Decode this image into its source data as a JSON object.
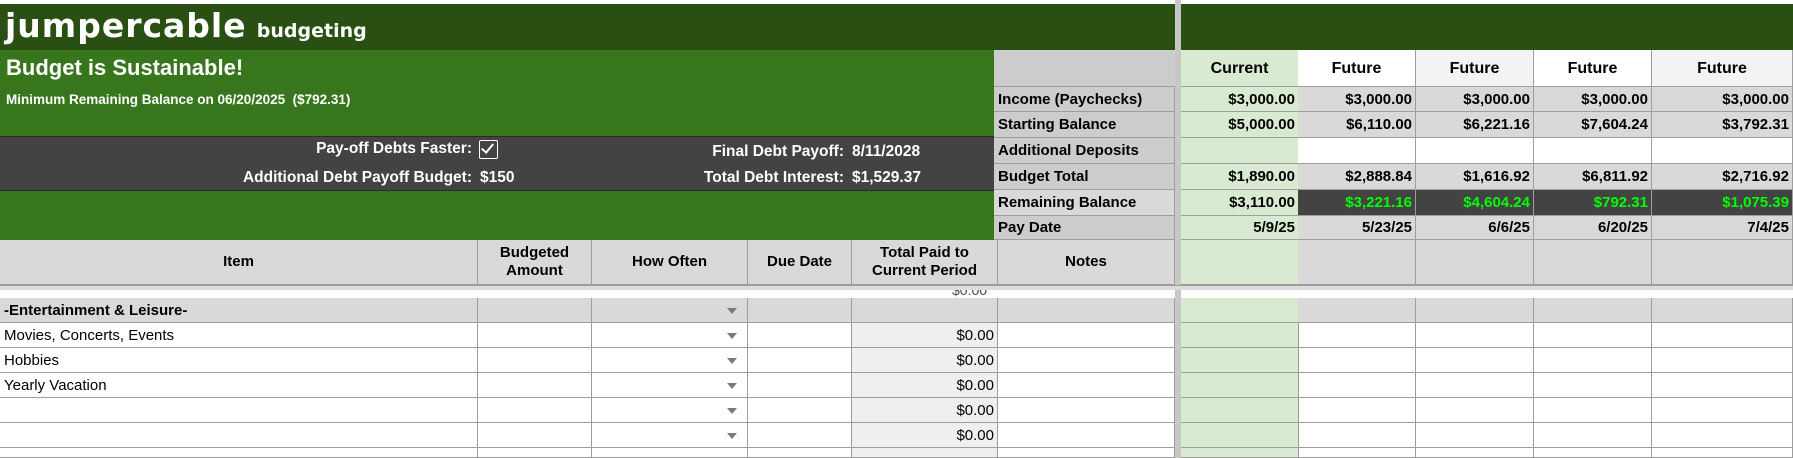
{
  "app": {
    "logo": "JumperCable",
    "subtitle": "Budgeting"
  },
  "status": {
    "headline": "Budget is Sustainable!",
    "min_balance_text": "Minimum Remaining Balance on 06/20/2025",
    "min_balance_value": "($792.31)"
  },
  "settings": {
    "payoff_faster_label": "Pay-off Debts Faster:",
    "payoff_faster_checked": true,
    "extra_budget_label": "Additional Debt Payoff Budget:",
    "extra_budget_value": "$150",
    "final_payoff_label": "Final Debt Payoff:",
    "final_payoff_value": "8/11/2028",
    "total_interest_label": "Total Debt Interest:",
    "total_interest_value": "$1,529.37"
  },
  "summary": {
    "row_labels": [
      "Income (Paychecks)",
      "Starting Balance",
      "Additional Deposits",
      "Budget Total",
      "Remaining Balance",
      "Pay Date"
    ],
    "periods": [
      {
        "header": "Current",
        "income": "$3,000.00",
        "start": "$5,000.00",
        "deposits": "",
        "total": "$1,890.00",
        "remaining": "$3,110.00",
        "date": "5/9/25"
      },
      {
        "header": "Future",
        "income": "$3,000.00",
        "start": "$6,110.00",
        "deposits": "",
        "total": "$2,888.84",
        "remaining": "$3,221.16",
        "date": "5/23/25"
      },
      {
        "header": "Future",
        "income": "$3,000.00",
        "start": "$6,221.16",
        "deposits": "",
        "total": "$1,616.92",
        "remaining": "$4,604.24",
        "date": "6/6/25"
      },
      {
        "header": "Future",
        "income": "$3,000.00",
        "start": "$7,604.24",
        "deposits": "",
        "total": "$6,811.92",
        "remaining": "$792.31",
        "date": "6/20/25"
      },
      {
        "header": "Future",
        "income": "$3,000.00",
        "start": "$3,792.31",
        "deposits": "",
        "total": "$2,716.92",
        "remaining": "$1,075.39",
        "date": "7/4/25"
      }
    ]
  },
  "table": {
    "headers": [
      "Item",
      "Budgeted Amount",
      "How Often",
      "Due Date",
      "Total Paid to Current Period",
      "Notes"
    ],
    "category": "-Entertainment & Leisure-",
    "rows": [
      {
        "item": "Movies, Concerts, Events",
        "paid": "$0.00"
      },
      {
        "item": "Hobbies",
        "paid": "$0.00"
      },
      {
        "item": "Yearly Vacation",
        "paid": "$0.00"
      },
      {
        "item": "",
        "paid": "$0.00"
      },
      {
        "item": "",
        "paid": "$0.00"
      }
    ]
  },
  "colors": {
    "positive": "#00ff00",
    "header_dark": "#294f13",
    "header_green": "#38761d",
    "panel_gray": "#434343"
  }
}
